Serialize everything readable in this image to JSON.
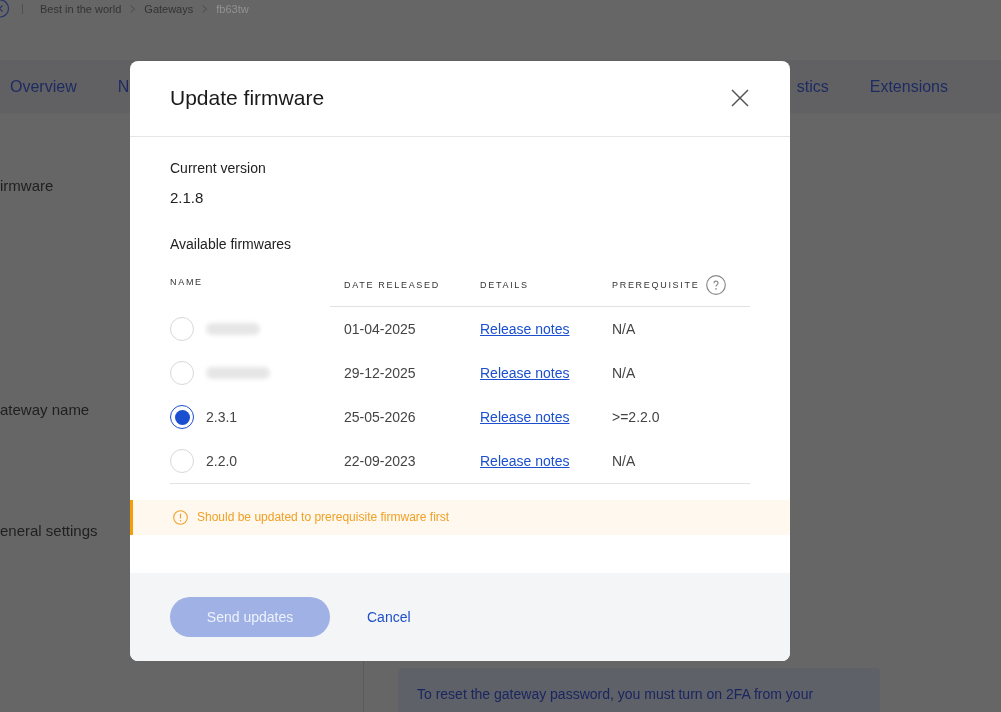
{
  "breadcrumb": {
    "items": [
      {
        "label": "Best in the world",
        "current": false
      },
      {
        "label": "Gateways",
        "current": false
      },
      {
        "label": "fb63tw",
        "current": true
      }
    ]
  },
  "tabs": [
    {
      "label": "Overview"
    },
    {
      "label": "N"
    },
    {
      "label": "stics"
    },
    {
      "label": "Extensions"
    }
  ],
  "settings_sections": [
    {
      "label": "irmware"
    },
    {
      "label": "ateway name"
    },
    {
      "label": "eneral settings"
    }
  ],
  "info_box": {
    "text": "To reset the gateway password, you must turn on 2FA from your"
  },
  "dialog": {
    "title": "Update firmware",
    "current_version_label": "Current version",
    "current_version": "2.1.8",
    "available_label": "Available firmwares",
    "table": {
      "columns": [
        {
          "label": "NAME",
          "help": false
        },
        {
          "label": "DATE RELEASED",
          "help": false
        },
        {
          "label": "DETAILS",
          "help": false
        },
        {
          "label": "PREREQUISITE",
          "help": true
        }
      ],
      "rows": [
        {
          "redacted": true,
          "selected": false,
          "date": "01-04-2025",
          "details": "Release notes",
          "prerequisite": "N/A"
        },
        {
          "redacted": true,
          "selected": false,
          "date": "29-12-2025",
          "details": "Release notes",
          "prerequisite": "N/A"
        },
        {
          "redacted": false,
          "name": "2.3.1",
          "selected": true,
          "date": "25-05-2026",
          "details": "Release notes",
          "prerequisite": ">=2.2.0"
        },
        {
          "redacted": false,
          "name": "2.2.0",
          "selected": false,
          "date": "22-09-2023",
          "details": "Release notes",
          "prerequisite": "N/A"
        }
      ]
    },
    "warning": {
      "text": "Should be updated to prerequisite firmware first"
    },
    "buttons": [
      {
        "label": "Send updates",
        "kind": "primary",
        "disabled": true
      },
      {
        "label": "Cancel",
        "kind": "link",
        "disabled": false
      }
    ]
  }
}
